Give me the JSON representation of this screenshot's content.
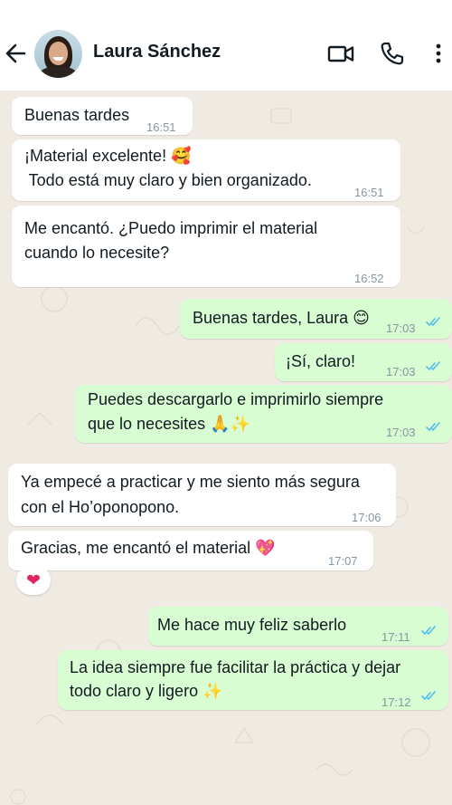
{
  "header": {
    "contact_name": "Laura Sánchez",
    "back_icon": "arrow-left-icon",
    "video_icon": "video-camera-icon",
    "call_icon": "phone-icon",
    "menu_icon": "more-vertical-icon"
  },
  "messages": [
    {
      "direction": "incoming",
      "lines": [
        "Buenas tardes"
      ],
      "time": "16:51"
    },
    {
      "direction": "incoming",
      "lines": [
        "¡Material excelente! 🥰",
        " Todo está muy claro y bien organizado."
      ],
      "time": "16:51"
    },
    {
      "direction": "incoming",
      "lines": [
        "Me encantó. ¿Puedo imprimir el material",
        "cuando lo necesite?"
      ],
      "time": "16:52"
    },
    {
      "direction": "outgoing",
      "lines": [
        "Buenas tardes, Laura 😊"
      ],
      "time": "17:03",
      "status": "read"
    },
    {
      "direction": "outgoing",
      "lines": [
        "¡Sí, claro!"
      ],
      "time": "17:03",
      "status": "read"
    },
    {
      "direction": "outgoing",
      "lines": [
        "Puedes descargarlo e imprimirlo siempre",
        "que lo necesites 🙏✨"
      ],
      "time": "17:03",
      "status": "read"
    },
    {
      "direction": "incoming",
      "lines": [
        "Ya empecé a practicar y me siento más segura",
        "con el Ho’oponopono."
      ],
      "time": "17:06"
    },
    {
      "direction": "incoming",
      "lines": [
        "Gracias, me encantó el material 💖"
      ],
      "time": "17:07",
      "reaction": "❤"
    },
    {
      "direction": "outgoing",
      "lines": [
        "Me hace muy feliz saberlo"
      ],
      "time": "17:11",
      "status": "read"
    },
    {
      "direction": "outgoing",
      "lines": [
        "La idea siempre fue facilitar la práctica y dejar",
        "todo claro y ligero ✨"
      ],
      "time": "17:12",
      "status": "read"
    }
  ],
  "colors": {
    "chat_background": "#efeae2",
    "incoming_bubble": "#ffffff",
    "outgoing_bubble": "#d9fdd3",
    "read_ticks": "#53bdeb",
    "timestamp": "#8696a0"
  }
}
